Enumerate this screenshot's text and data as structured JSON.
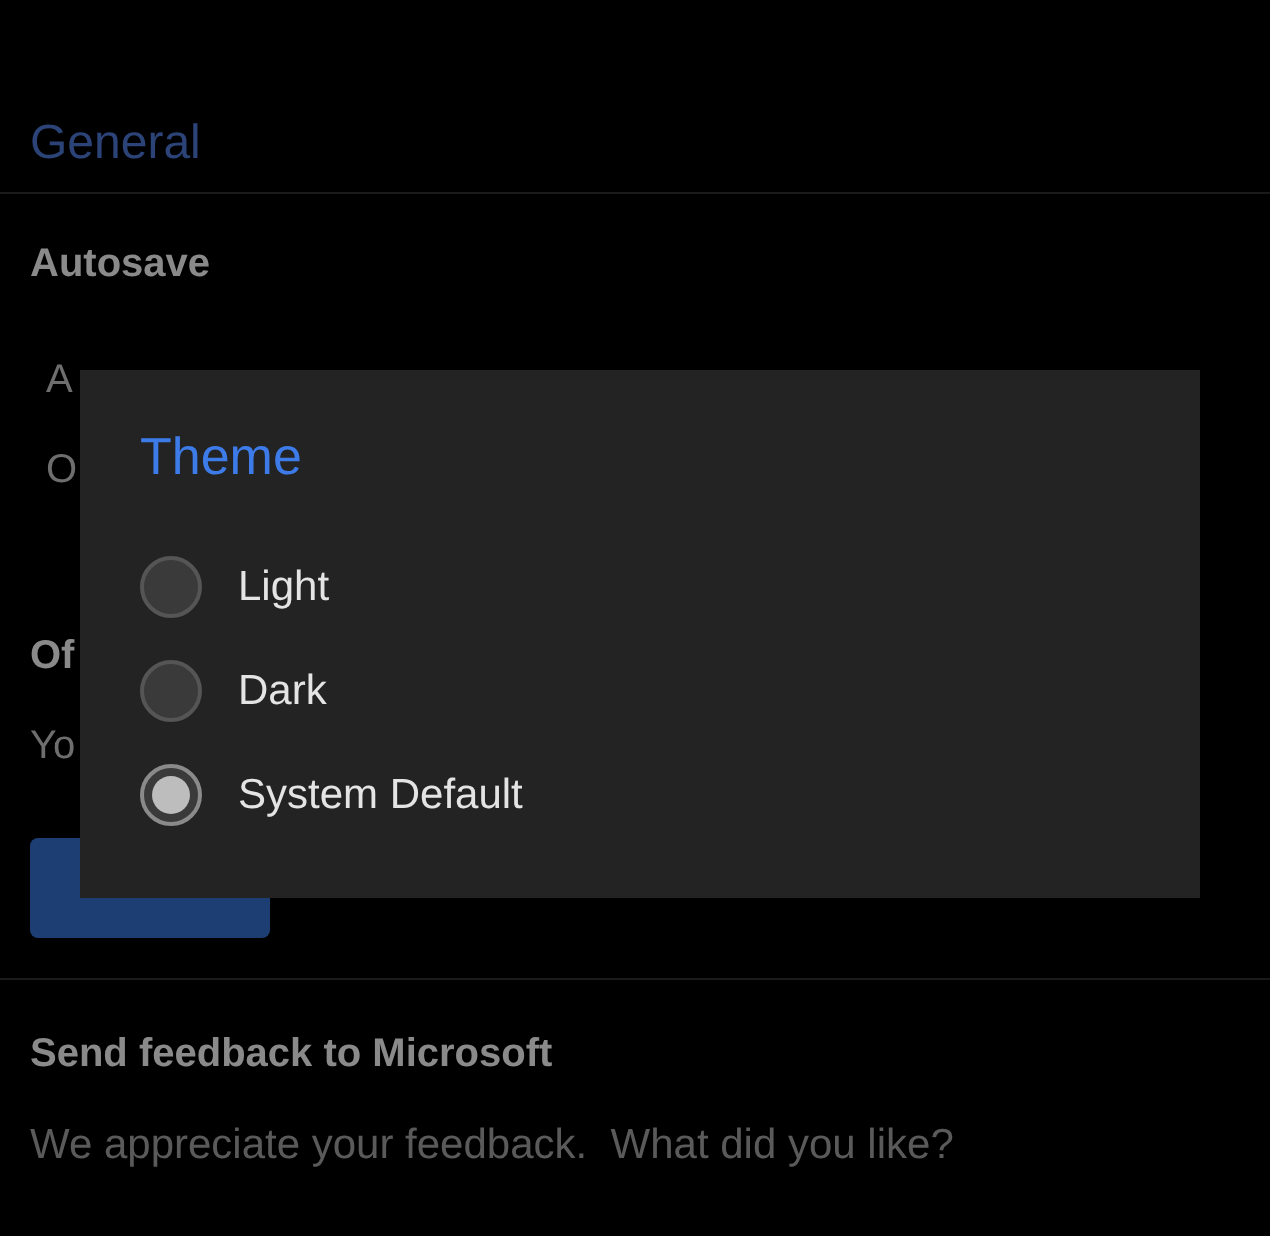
{
  "settings": {
    "section_title": "General",
    "autosave": {
      "title": "Autosave",
      "lines": [
        "A",
        "O"
      ]
    },
    "office": {
      "title": "Of",
      "line": "Yo"
    },
    "feedback": {
      "title": "Send feedback to Microsoft",
      "text": "We appreciate your feedback.  What did you like?"
    }
  },
  "dialog": {
    "title": "Theme",
    "options": [
      {
        "label": "Light",
        "selected": false
      },
      {
        "label": "Dark",
        "selected": false
      },
      {
        "label": "System Default",
        "selected": true
      }
    ]
  }
}
